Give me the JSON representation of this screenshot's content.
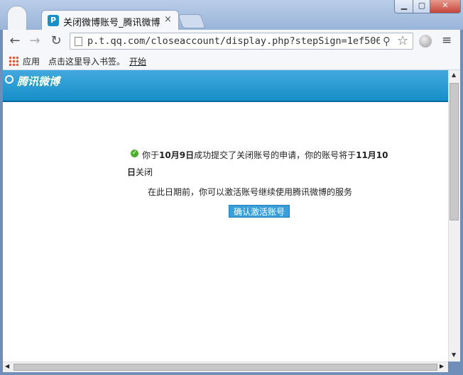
{
  "window": {
    "tab_title": "关闭微博账号_腾讯微博",
    "tab_favicon": "P",
    "close_glyph": "×",
    "min_glyph": "▁",
    "max_glyph": "▢",
    "win_close_glyph": "✕"
  },
  "toolbar": {
    "url": "p.t.qq.com/closeaccount/display.php?stepSign=1ef506",
    "back_glyph": "←",
    "forward_glyph": "→",
    "reload_glyph": "↻",
    "zoom_glyph": "⚲",
    "star_glyph": "☆",
    "menu_glyph": "≡"
  },
  "bookmarks": {
    "apps_label": "应用",
    "import_label": "点击这里导入书签。",
    "start_label": "开始"
  },
  "page": {
    "logo_text": "腾讯微博",
    "msg_part1": "你于",
    "close_date": "10月9日",
    "msg_part2": "成功提交了关闭账号的申请，你的账号将于",
    "close_final_part1": "11月10",
    "close_final_part2": "日",
    "msg_part3": "关闭",
    "reactivate_hint": "在此日期前，你可以激活账号继续使用腾讯微博的服务",
    "confirm_button": "确认激活账号",
    "check_glyph": "✓"
  },
  "scrollbars": {
    "up_glyph": "▲",
    "down_glyph": "▼",
    "left_glyph": "◀",
    "right_glyph": "▶"
  }
}
